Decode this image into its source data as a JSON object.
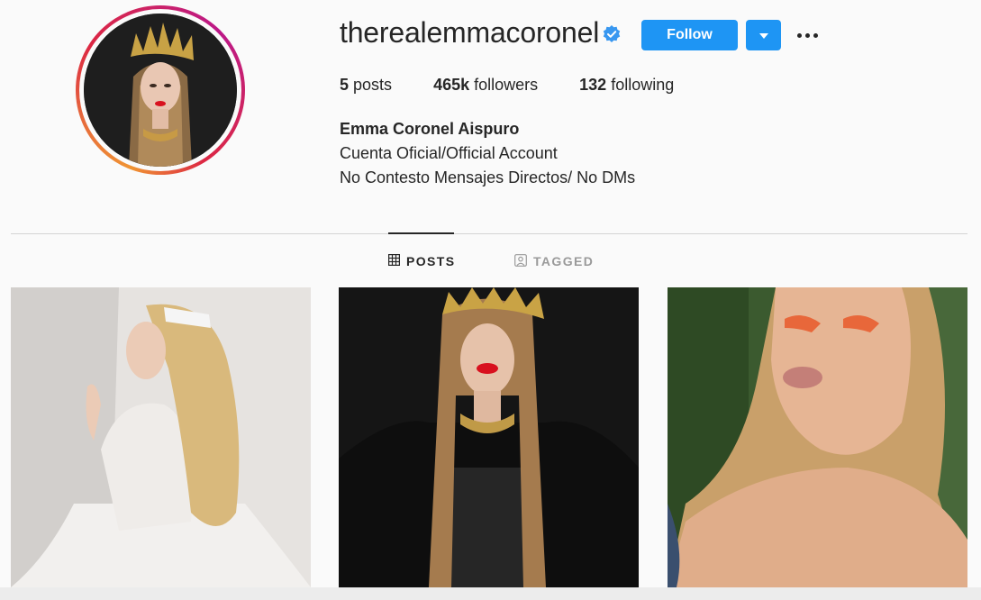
{
  "profile": {
    "username": "therealemmacoronel",
    "verified_icon": "verified-badge-icon",
    "full_name": "Emma Coronel Aispuro",
    "bio_lines": [
      "Cuenta Oficial/Official Account",
      "No Contesto Mensajes Directos/ No DMs"
    ]
  },
  "actions": {
    "follow_label": "Follow",
    "dropdown_icon": "chevron-down-icon",
    "more_icon": "more-options-icon"
  },
  "stats": {
    "posts_count": "5",
    "posts_label": "posts",
    "followers_count": "465k",
    "followers_label": "followers",
    "following_count": "132",
    "following_label": "following"
  },
  "tabs": [
    {
      "label": "POSTS",
      "icon": "grid-icon",
      "active": true
    },
    {
      "label": "TAGGED",
      "icon": "tagged-icon",
      "active": false
    }
  ],
  "colors": {
    "accent": "#1e95f4",
    "text": "#262626",
    "muted": "#9a9a9a",
    "background": "#fafafa"
  }
}
